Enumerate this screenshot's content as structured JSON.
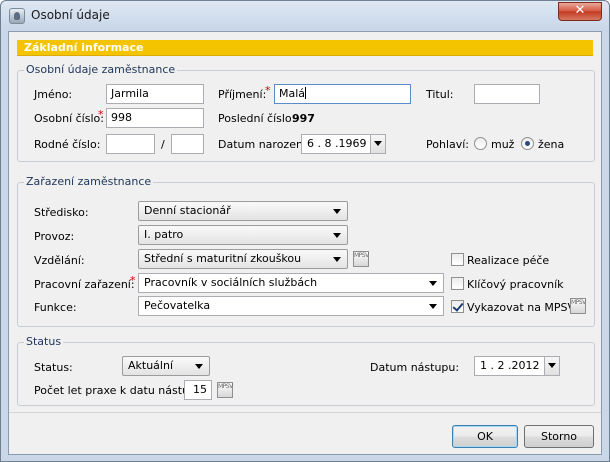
{
  "window": {
    "title": "Osobní údaje",
    "close_label": "✕"
  },
  "header": {
    "title": "Základní informace"
  },
  "personal": {
    "legend": "Osobní údaje zaměstnance",
    "jmeno_label": "Jméno:",
    "jmeno_value": "Jarmila",
    "prijmeni_label": "Příjmení:",
    "prijmeni_value": "Malá",
    "titul_label": "Titul:",
    "titul_value": "",
    "osobni_cislo_label": "Osobní číslo:",
    "osobni_cislo_value": "998",
    "posledni_cislo_label": "Poslední číslo:",
    "posledni_cislo_value": "997",
    "rodne_cislo_label": "Rodné číslo:",
    "rodne_cislo_part1": "",
    "rodne_cislo_separator": "/",
    "rodne_cislo_part2": "",
    "datum_narozeni_label": "Datum narození:",
    "datum_narozeni_value": "6 . 8 .1969",
    "pohlavi_label": "Pohlaví:",
    "pohlavi_options": [
      "muž",
      "žena"
    ],
    "pohlavi_selected": "žena"
  },
  "assignment": {
    "legend": "Zařazení zaměstnance",
    "stredisko_label": "Středisko:",
    "stredisko_value": "Denní stacionář",
    "provoz_label": "Provoz:",
    "provoz_value": "I. patro",
    "vzdelani_label": "Vzdělání:",
    "vzdelani_value": "Střední s maturitní zkouškou",
    "pracovni_zarazeni_label": "Pracovní zařazení:",
    "pracovni_zarazeni_value": "Pracovník v sociálních službách",
    "funkce_label": "Funkce:",
    "funkce_value": "Pečovatelka",
    "realizace_pece_label": "Realizace péče",
    "realizace_pece_checked": false,
    "klicovy_pracovnik_label": "Klíčový pracovník",
    "klicovy_pracovnik_checked": false,
    "vykazovat_label": "Vykazovat na MPSV",
    "vykazovat_checked": true,
    "mpsv_icon_text": "MPSV"
  },
  "status": {
    "legend": "Status",
    "status_label": "Status:",
    "status_value": "Aktuální",
    "datum_nastupu_label": "Datum nástupu:",
    "datum_nastupu_value": "1 . 2 .2012",
    "pocet_let_label": "Počet let praxe k datu nástupu:",
    "pocet_let_value": "15"
  },
  "buttons": {
    "ok": "OK",
    "cancel": "Storno"
  },
  "colors": {
    "header_bg": "#f4c400",
    "required": "#cc0000",
    "legend_text": "#1e3657"
  }
}
